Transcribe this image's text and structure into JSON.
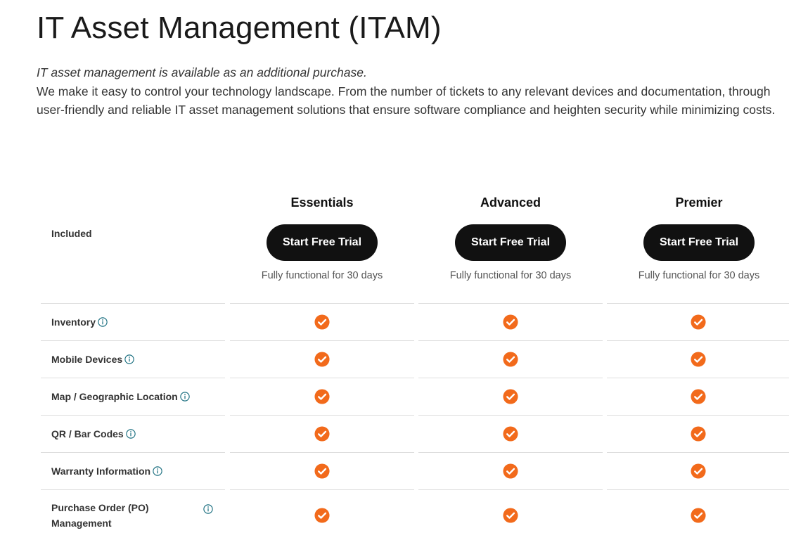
{
  "header": {
    "title": "IT Asset Management (ITAM)",
    "note": "IT asset management is available as an additional purchase.",
    "description": "We make it easy to control your technology landscape. From the number of tickets to any relevant devices and documentation, through user-friendly and reliable IT asset management solutions that ensure software compliance and heighten security while minimizing costs."
  },
  "table": {
    "included_label": "Included",
    "plans": [
      {
        "name": "Essentials",
        "button_label": "Start Free Trial",
        "subtext": "Fully functional for 30 days"
      },
      {
        "name": "Advanced",
        "button_label": "Start Free Trial",
        "subtext": "Fully functional for 30 days"
      },
      {
        "name": "Premier",
        "button_label": "Start Free Trial",
        "subtext": "Fully functional for 30 days"
      }
    ],
    "features": [
      {
        "label": "Inventory",
        "icon": "info-icon",
        "included": [
          true,
          true,
          true
        ]
      },
      {
        "label": "Mobile Devices",
        "icon": "info-icon",
        "included": [
          true,
          true,
          true
        ]
      },
      {
        "label": "Map / Geographic Location",
        "icon": "info-icon",
        "included": [
          true,
          true,
          true
        ]
      },
      {
        "label": "QR / Bar Codes",
        "icon": "info-icon",
        "included": [
          true,
          true,
          true
        ]
      },
      {
        "label": "Warranty Information",
        "icon": "info-icon",
        "included": [
          true,
          true,
          true
        ]
      },
      {
        "label": "Purchase Order (PO) Management",
        "icon": "info-icon",
        "included": [
          true,
          true,
          true
        ]
      }
    ]
  },
  "colors": {
    "check": "#f26a1b",
    "button_bg": "#111111",
    "info_icon": "#1b6f80",
    "divider": "#dddddd"
  }
}
